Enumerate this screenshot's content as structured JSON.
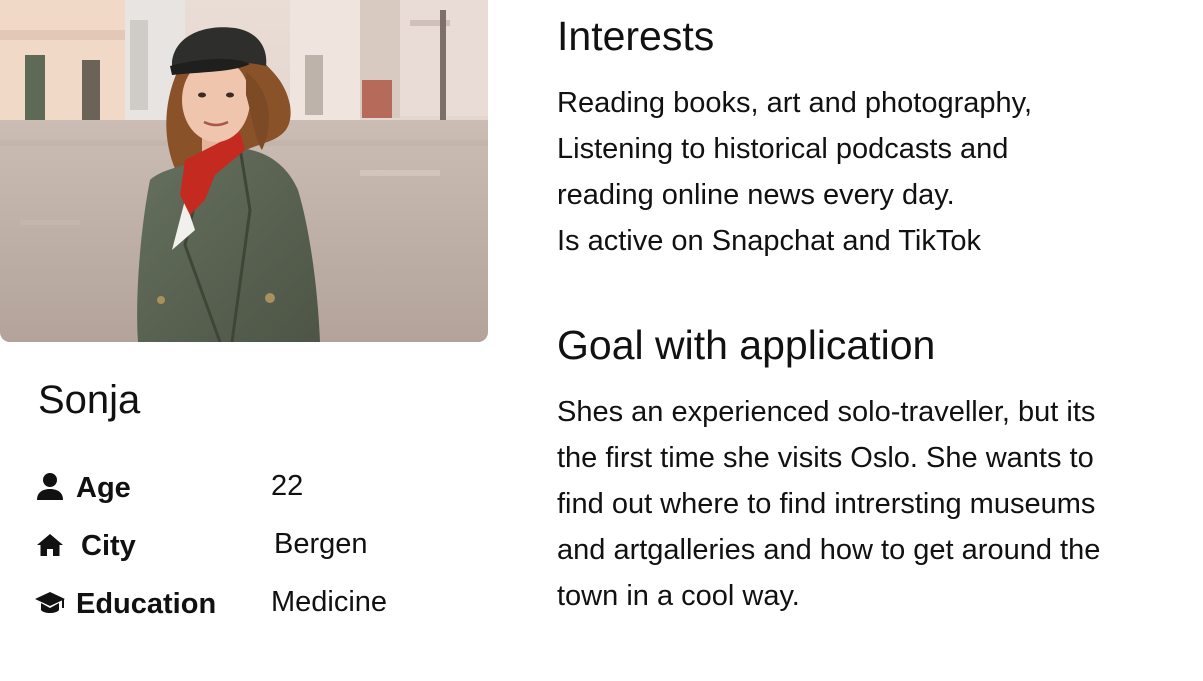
{
  "profile": {
    "name": "Sonja",
    "attributes": [
      {
        "icon": "person-icon",
        "label": "Age",
        "value": "22"
      },
      {
        "icon": "home-icon",
        "label": "City",
        "value": "Bergen"
      },
      {
        "icon": "graduation-cap-icon",
        "label": "Education",
        "value": "Medicine"
      }
    ]
  },
  "interests": {
    "title": "Interests",
    "lines": [
      "Reading books, art and photography,",
      "Listening to historical podcasts and",
      "reading online news every day.",
      "Is active on Snapchat and TikTok"
    ]
  },
  "goal": {
    "title": "Goal with application",
    "lines": [
      "Shes an experienced solo-traveller, but its",
      "the first time she visits Oslo. She wants to",
      "find out where to find intrersting museums",
      "and artgalleries and how to get around the",
      "town in a cool way."
    ]
  },
  "colors": {
    "text": "#111111",
    "background": "#ffffff"
  }
}
